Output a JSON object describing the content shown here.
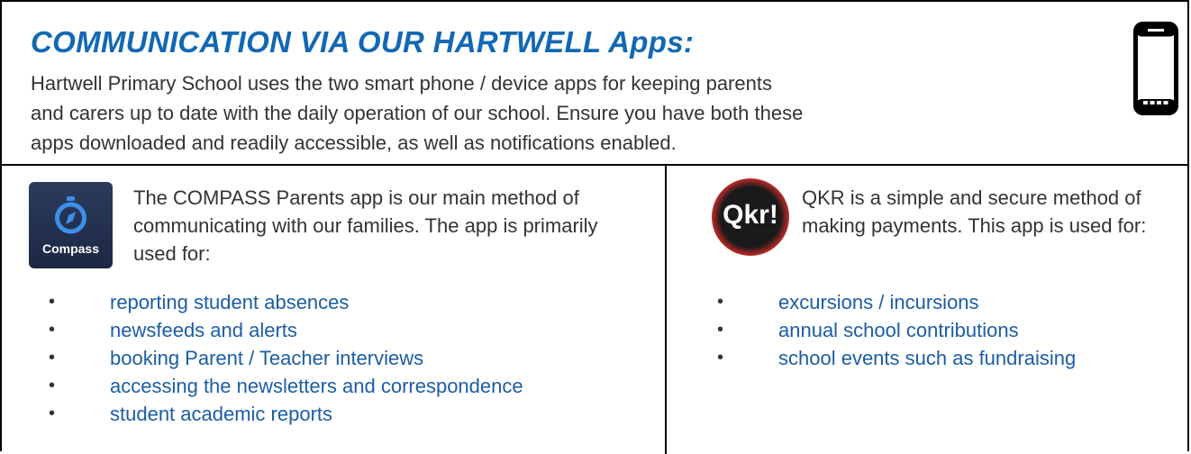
{
  "header": {
    "title": "COMMUNICATION VIA OUR HARTWELL Apps:",
    "intro": "Hartwell Primary School uses the two smart phone / device apps for keeping parents and carers up to date with the daily operation of our school.  Ensure you have both these apps downloaded and readily accessible, as well as notifications enabled."
  },
  "compass": {
    "logo_label": "Compass",
    "description": "The COMPASS Parents app is our main method of communicating with our families.   The app is primarily used for:",
    "items": [
      "reporting student absences",
      "newsfeeds and alerts",
      "booking Parent / Teacher interviews",
      "accessing the newsletters and correspondence",
      "student academic reports"
    ]
  },
  "qkr": {
    "logo_label": "Qkr!",
    "description": " QKR is a simple and secure method of making payments.  This app is used for:",
    "items": [
      "excursions / incursions",
      "annual school contributions",
      "school events such as fundraising"
    ]
  },
  "bullet_char": "•",
  "colors": {
    "title": "#1268b3",
    "list_text": "#1c5da5",
    "body_text": "#333333"
  },
  "icons": {
    "phone": "smartphone-icon",
    "compass": "compass-app-icon",
    "qkr": "qkr-app-icon"
  }
}
